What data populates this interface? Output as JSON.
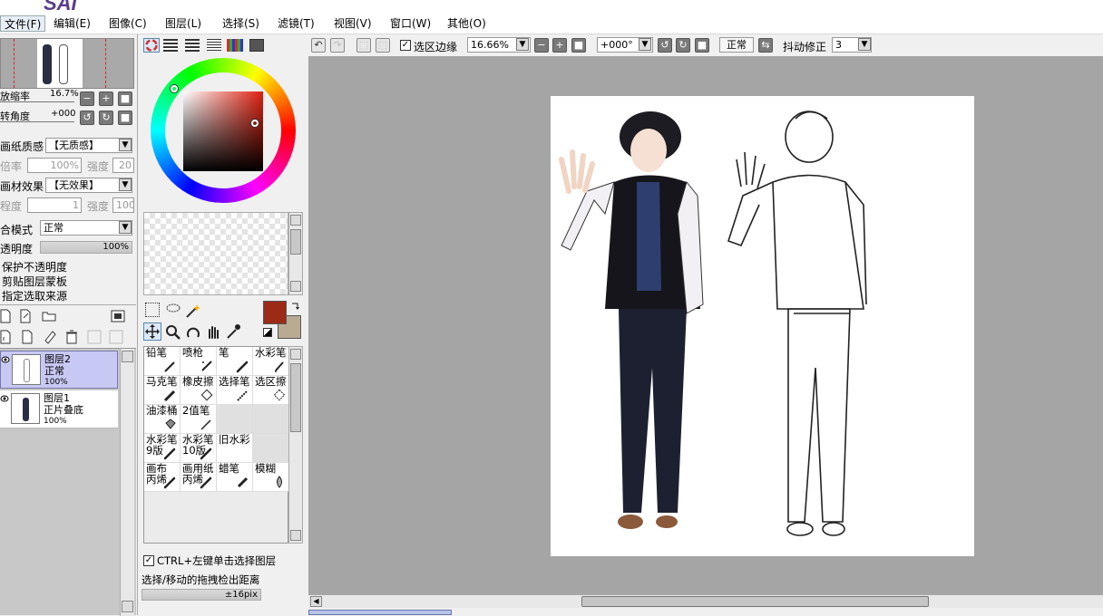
{
  "app": {
    "logo_text": "SAI"
  },
  "menu": [
    {
      "label": "文件(F)"
    },
    {
      "label": "编辑(E)"
    },
    {
      "label": "图像(C)"
    },
    {
      "label": "图层(L)"
    },
    {
      "label": "选择(S)"
    },
    {
      "label": "滤镜(T)"
    },
    {
      "label": "视图(V)"
    },
    {
      "label": "窗口(W)"
    },
    {
      "label": "其他(O)"
    }
  ],
  "navigator": {
    "zoom_label": "放缩率",
    "zoom_value": "16.7%",
    "angle_label": "转角度",
    "angle_value": "+000"
  },
  "paper_texture": {
    "label": "画纸质感",
    "value": "【无质感】",
    "rate_label": "倍率",
    "rate_value": "100%",
    "strength_label": "强度",
    "strength_value": "20"
  },
  "material_effect": {
    "label": "画材效果",
    "value": "【无效果】",
    "degree_label": "程度",
    "degree_value": "1",
    "strength_label": "强度",
    "strength_value": "100"
  },
  "blend": {
    "mode_label": "合模式",
    "mode_value": "正常",
    "opacity_label": "透明度",
    "opacity_value": "100%"
  },
  "layer_options": [
    "保护不透明度",
    "剪贴图层蒙板",
    "指定选取来源"
  ],
  "layers": [
    {
      "name": "图层2",
      "mode": "正常",
      "opacity": "100%",
      "selected": true
    },
    {
      "name": "图层1",
      "mode": "正片叠底",
      "opacity": "100%",
      "selected": false
    }
  ],
  "colors": {
    "primary": "#9b2a17",
    "secondary": "#b9ab93",
    "accent": "#c8c8f4"
  },
  "tools": [
    {
      "label": "铅笔",
      "label2": "",
      "icon": "pencil-icon"
    },
    {
      "label": "喷枪",
      "label2": "",
      "icon": "airbrush-icon"
    },
    {
      "label": "笔",
      "label2": "",
      "icon": "brush-icon"
    },
    {
      "label": "水彩笔",
      "label2": "",
      "icon": "watercolor-icon"
    },
    {
      "label": "马克笔",
      "label2": "",
      "icon": "marker-icon"
    },
    {
      "label": "橡皮擦",
      "label2": "",
      "icon": "eraser-icon"
    },
    {
      "label": "选择笔",
      "label2": "",
      "icon": "select-pen-icon"
    },
    {
      "label": "选区擦",
      "label2": "",
      "icon": "select-eraser-icon"
    },
    {
      "label": "油漆桶",
      "label2": "",
      "icon": "bucket-icon"
    },
    {
      "label": "2值笔",
      "label2": "",
      "icon": "binary-pen-icon"
    },
    {
      "label": "",
      "label2": "",
      "icon": ""
    },
    {
      "label": "",
      "label2": "",
      "icon": ""
    },
    {
      "label": "水彩笔",
      "label2": "9版",
      "icon": "brush-icon"
    },
    {
      "label": "水彩笔",
      "label2": "10版",
      "icon": "brush-icon"
    },
    {
      "label": "旧水彩",
      "label2": "",
      "icon": ""
    },
    {
      "label": "",
      "label2": "",
      "icon": ""
    },
    {
      "label": "画布",
      "label2": "丙烯",
      "icon": "brush-icon"
    },
    {
      "label": "画用纸",
      "label2": "丙烯",
      "icon": "brush-icon"
    },
    {
      "label": "蜡笔",
      "label2": "",
      "icon": "crayon-icon"
    },
    {
      "label": "模糊",
      "label2": "",
      "icon": "blur-icon"
    }
  ],
  "tool_options": {
    "ctrl_select_label": "CTRL+左键单击选择图层",
    "drag_distance_label": "选择/移动的拖拽检出距离",
    "drag_distance_value": "±16pix"
  },
  "canvas_toolbar": {
    "selection_edge_label": "选区边缘",
    "zoom": "16.66%",
    "rotation": "+000°",
    "mode": "正常",
    "stabilizer_label": "抖动修正",
    "stabilizer_value": "3"
  }
}
